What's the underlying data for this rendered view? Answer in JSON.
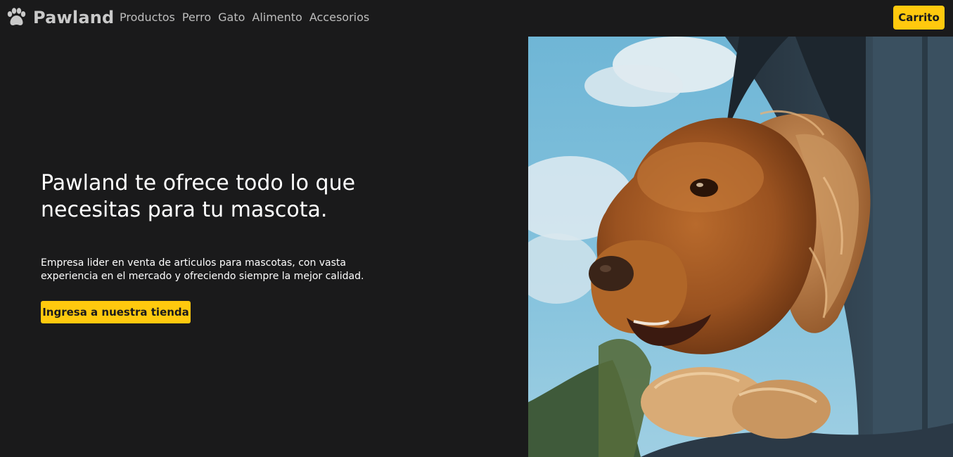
{
  "brand": {
    "name": "Pawland",
    "icon": "paw-icon"
  },
  "nav": {
    "links": [
      "Productos",
      "Perro",
      "Gato",
      "Alimento",
      "Accesorios"
    ]
  },
  "cart": {
    "label": "Carrito"
  },
  "hero": {
    "title_line1": "Pawland te ofrece todo lo que",
    "title_line2": "necesitas para tu mascota.",
    "description_line1": "Empresa lider en venta de articulos para mascotas, con vasta",
    "description_line2": "experiencia en el mercado y ofreciendo siempre la mejor calidad.",
    "cta_label": "Ingresa a nuestra tienda",
    "image": "dog-in-car-window-photo"
  },
  "colors": {
    "background": "#1a1a1b",
    "accent": "#ffc90e",
    "nav_text": "#bdbdbd",
    "text": "#ffffff"
  }
}
